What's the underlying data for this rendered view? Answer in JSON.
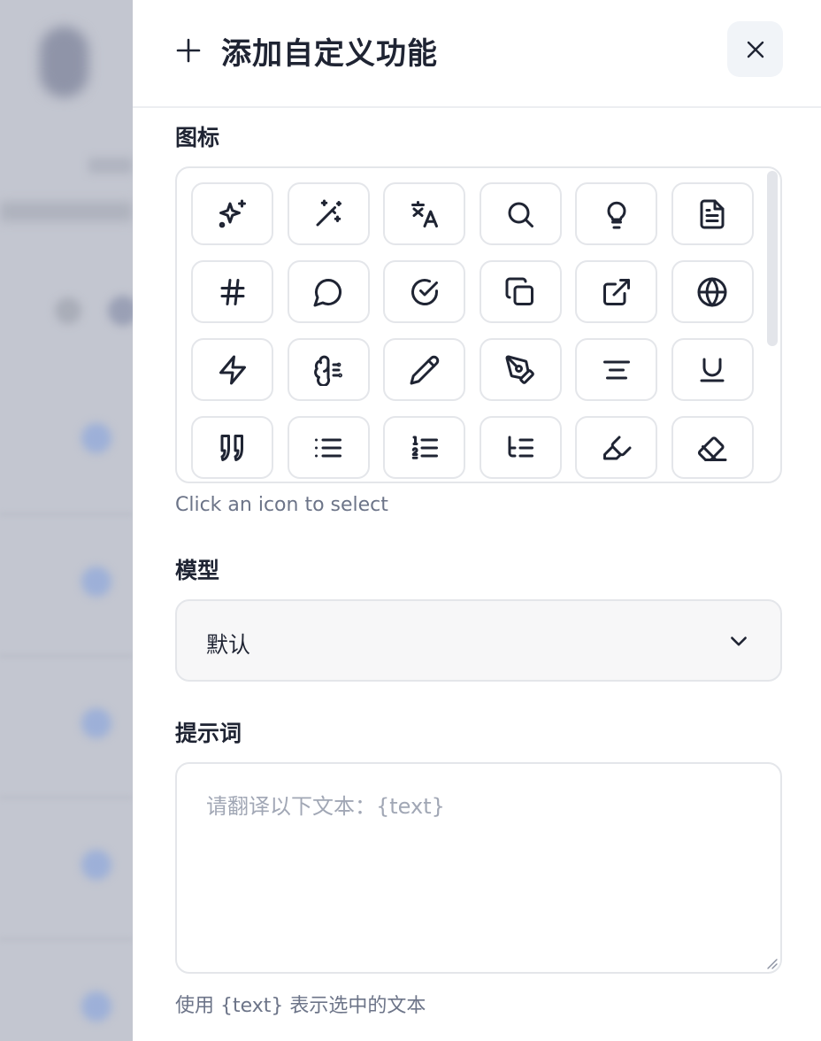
{
  "dialog": {
    "title": "添加自定义功能",
    "icon_section": {
      "label": "图标",
      "icons": [
        "sparkles-icon",
        "magic-wand-icon",
        "translate-icon",
        "search-icon",
        "lightbulb-icon",
        "file-text-icon",
        "hash-icon",
        "message-circle-icon",
        "check-circle-icon",
        "copy-icon",
        "external-link-icon",
        "globe-icon",
        "zap-icon",
        "brain-icon",
        "pencil-icon",
        "pen-tool-icon",
        "align-center-icon",
        "underline-icon",
        "quote-icon",
        "list-icon",
        "list-ordered-icon",
        "list-tree-icon",
        "highlighter-icon",
        "eraser-icon"
      ],
      "hint": "Click an icon to select"
    },
    "model_section": {
      "label": "模型",
      "selected": "默认"
    },
    "prompt_section": {
      "label": "提示词",
      "placeholder": "请翻译以下文本：{text}",
      "value": "",
      "hint": "使用 {text} 表示选中的文本"
    }
  }
}
